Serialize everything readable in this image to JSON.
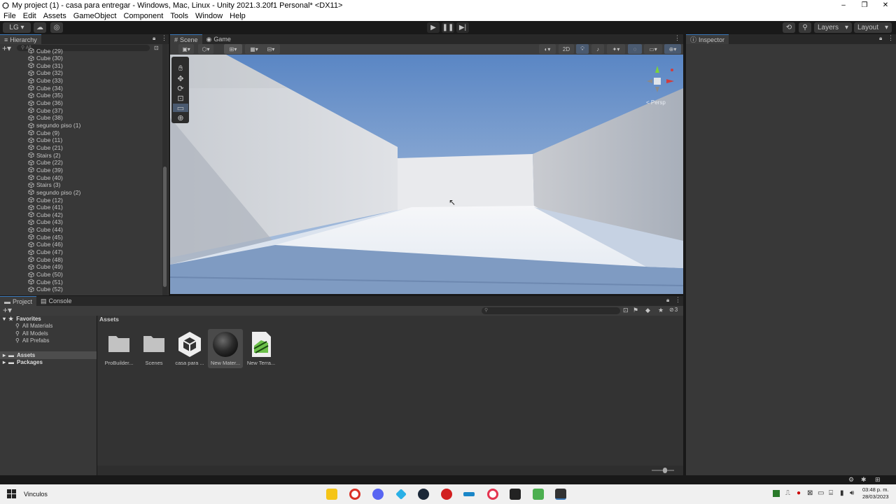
{
  "window": {
    "title": "My project (1) - casa para entregar - Windows, Mac, Linux - Unity 2021.3.20f1 Personal* <DX11>",
    "controls": [
      "–",
      "❐",
      "✕"
    ]
  },
  "menu": [
    "File",
    "Edit",
    "Assets",
    "GameObject",
    "Component",
    "Tools",
    "Window",
    "Help"
  ],
  "toolbar": {
    "account_label": "LG ▾",
    "layers_label": "Layers",
    "layout_label": "Layout"
  },
  "hierarchy": {
    "tab_label": "Hierarchy",
    "search_placeholder": "All",
    "items": [
      "Cube (29)",
      "Cube (30)",
      "Cube (31)",
      "Cube (32)",
      "Cube (33)",
      "Cube (34)",
      "Cube (35)",
      "Cube (36)",
      "Cube (37)",
      "Cube (38)",
      "segundo piso (1)",
      "Cube (9)",
      "Cube (11)",
      "Cube (21)",
      "Stairs (2)",
      "Cube (22)",
      "Cube (39)",
      "Cube (40)",
      "Stairs (3)",
      "segundo piso (2)",
      "Cube (12)",
      "Cube (41)",
      "Cube (42)",
      "Cube (43)",
      "Cube (44)",
      "Cube (45)",
      "Cube (46)",
      "Cube (47)",
      "Cube (48)",
      "Cube (49)",
      "Cube (50)",
      "Cube (51)",
      "Cube (52)"
    ]
  },
  "scene": {
    "tabs": [
      "Scene",
      "Game"
    ],
    "toggle_2d": "2D",
    "gizmo_label": "< Persp"
  },
  "inspector": {
    "tab_label": "Inspector"
  },
  "project": {
    "tabs": [
      "Project",
      "Console"
    ],
    "favorites_label": "Favorites",
    "favorites": [
      "All Materials",
      "All Models",
      "All Prefabs"
    ],
    "roots": [
      "Assets",
      "Packages"
    ],
    "breadcrumb": "Assets",
    "hidden_count": "3",
    "assets": [
      {
        "label": "ProBuilder...",
        "icon": "folder-icon"
      },
      {
        "label": "Scenes",
        "icon": "folder-icon"
      },
      {
        "label": "casa para ...",
        "icon": "unity-scene-icon"
      },
      {
        "label": "New Mater...",
        "icon": "material-sphere-icon"
      },
      {
        "label": "New Terra...",
        "icon": "terrain-icon"
      }
    ]
  },
  "taskbar": {
    "search_label": "Vinculos",
    "time": "03:48 p. m.",
    "date": "28/03/2023"
  },
  "colors": {
    "accent": "#3a79bb",
    "panel": "#383838",
    "toolbar": "#191919"
  }
}
